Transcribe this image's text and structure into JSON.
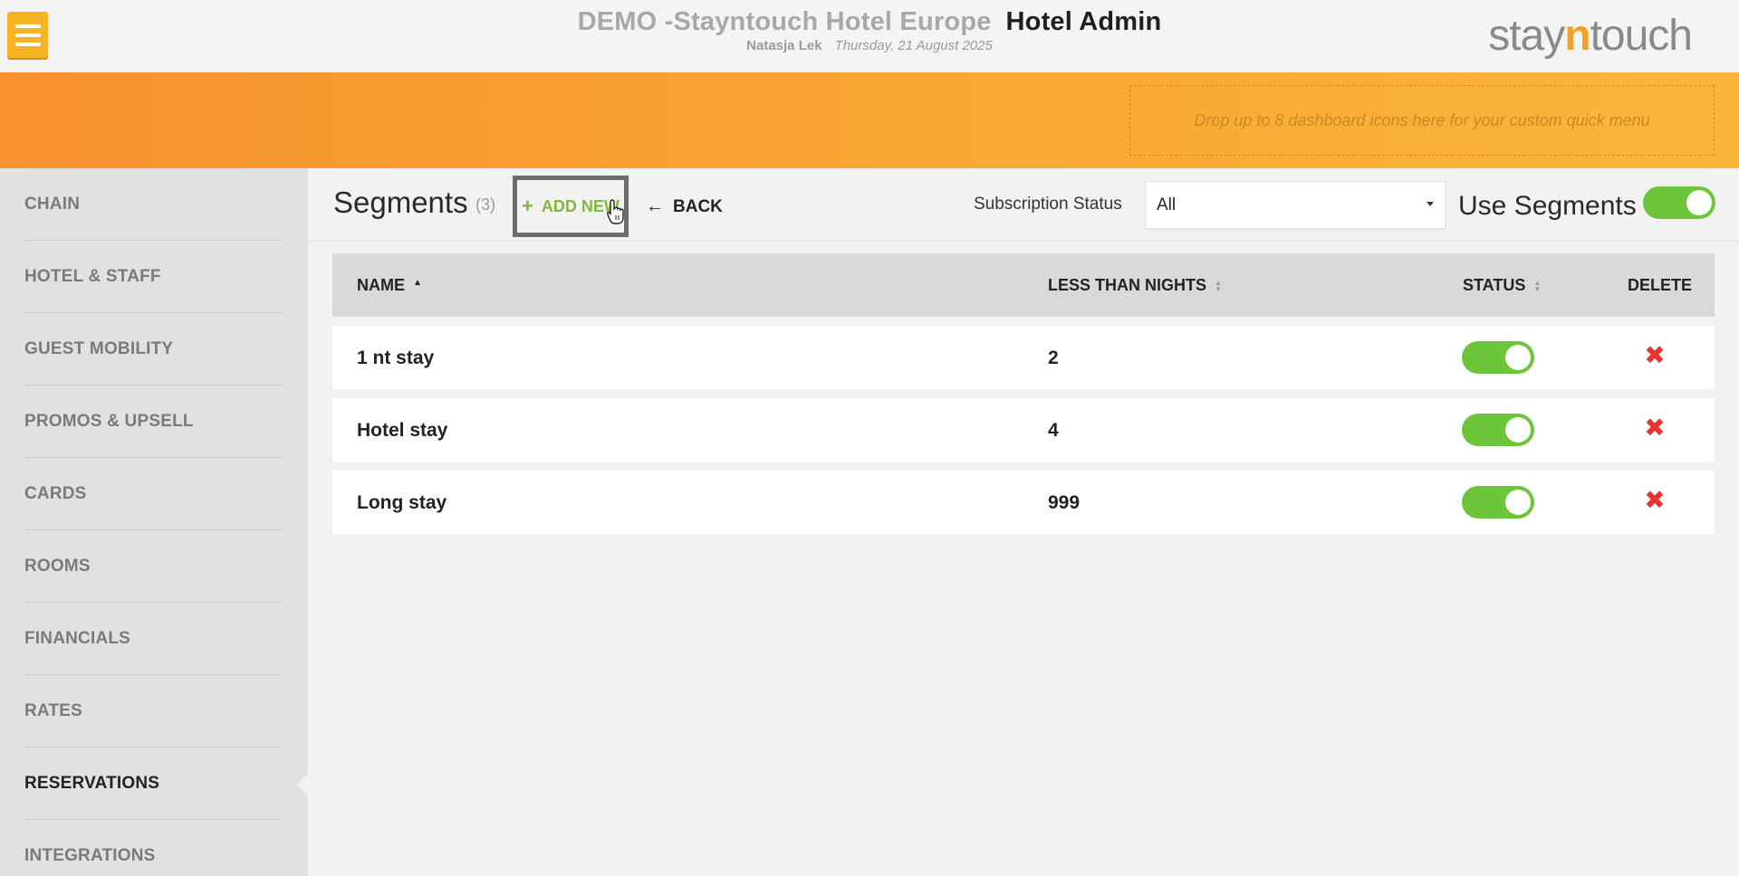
{
  "header": {
    "title": "DEMO -Stayntouch Hotel Europe",
    "section": "Hotel Admin",
    "user": "Natasja Lek",
    "date": "Thursday, 21 August 2025",
    "logo_prefix": "stay",
    "logo_accent": "n",
    "logo_suffix": "touch"
  },
  "banner": {
    "dropzone_text": "Drop up to 8 dashboard icons here for your custom quick menu"
  },
  "sidebar": {
    "items": [
      {
        "label": "CHAIN"
      },
      {
        "label": "HOTEL & STAFF"
      },
      {
        "label": "GUEST MOBILITY"
      },
      {
        "label": "PROMOS & UPSELL"
      },
      {
        "label": "CARDS"
      },
      {
        "label": "ROOMS"
      },
      {
        "label": "FINANCIALS"
      },
      {
        "label": "RATES"
      },
      {
        "label": "RESERVATIONS",
        "active": true
      },
      {
        "label": "INTEGRATIONS"
      }
    ]
  },
  "main": {
    "title": "Segments",
    "count": "(3)",
    "add_new_label": "ADD NEW",
    "back_label": "BACK",
    "subscription_label": "Subscription Status",
    "subscription_value": "All",
    "use_segments_label": "Use Segments",
    "use_segments_on": true
  },
  "table": {
    "headers": {
      "name": "NAME",
      "nights": "LESS THAN NIGHTS",
      "status": "STATUS",
      "delete": "DELETE"
    },
    "rows": [
      {
        "name": "1 nt stay",
        "nights": "2",
        "status": true
      },
      {
        "name": "Hotel stay",
        "nights": "4",
        "status": true
      },
      {
        "name": "Long stay",
        "nights": "999",
        "status": true
      }
    ]
  },
  "colors": {
    "accent_orange": "#f8922f",
    "toggle_green": "#6dc53a",
    "delete_red": "#e3342f",
    "add_green": "#7fb83a"
  }
}
